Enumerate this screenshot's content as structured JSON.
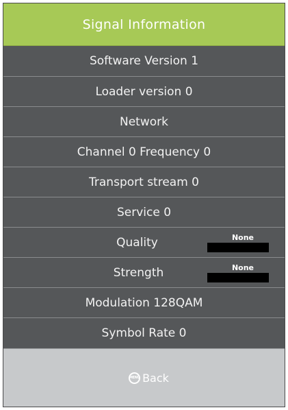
{
  "header": {
    "title": "Signal Information"
  },
  "rows": {
    "software": "Software Version 1",
    "loader": "Loader version 0",
    "network": "Network",
    "channel": "Channel 0 Frequency 0",
    "transport": "Transport stream 0",
    "service": "Service 0",
    "quality": {
      "label": "Quality",
      "value": "None"
    },
    "strength": {
      "label": "Strength",
      "value": "None"
    },
    "modulation": "Modulation 128QAM",
    "symbol_rate": "Symbol Rate 0"
  },
  "footer": {
    "back_label": "Back",
    "back_icon": "menu-button-icon"
  },
  "colors": {
    "header_bg": "#a7c956",
    "row_bg": "#555759",
    "footer_bg": "#c7c9cb"
  }
}
